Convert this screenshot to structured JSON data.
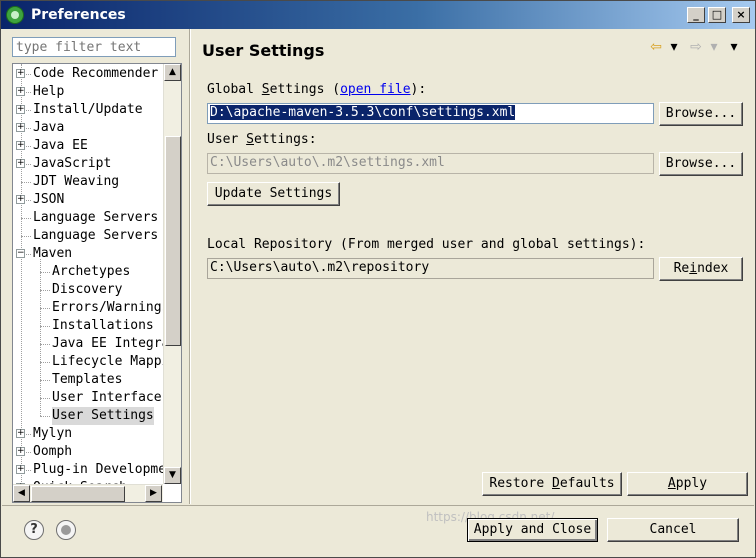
{
  "window": {
    "title": "Preferences",
    "minimize": "_",
    "maximize": "□",
    "close": "×"
  },
  "left": {
    "filter_placeholder": "type filter text",
    "tree": [
      {
        "label": "Code Recommender",
        "level": 0,
        "expander": "+"
      },
      {
        "label": "Help",
        "level": 0,
        "expander": "+"
      },
      {
        "label": "Install/Update",
        "level": 0,
        "expander": "+"
      },
      {
        "label": "Java",
        "level": 0,
        "expander": "+"
      },
      {
        "label": "Java EE",
        "level": 0,
        "expander": "+"
      },
      {
        "label": "JavaScript",
        "level": 0,
        "expander": "+"
      },
      {
        "label": "JDT Weaving",
        "level": 0,
        "expander": ""
      },
      {
        "label": "JSON",
        "level": 0,
        "expander": "+"
      },
      {
        "label": "Language Servers",
        "level": 0,
        "expander": ""
      },
      {
        "label": "Language Servers",
        "level": 0,
        "expander": ""
      },
      {
        "label": "Maven",
        "level": 0,
        "expander": "−"
      },
      {
        "label": "Archetypes",
        "level": 1,
        "expander": ""
      },
      {
        "label": "Discovery",
        "level": 1,
        "expander": ""
      },
      {
        "label": "Errors/Warnings",
        "level": 1,
        "expander": ""
      },
      {
        "label": "Installations",
        "level": 1,
        "expander": ""
      },
      {
        "label": "Java EE Integration",
        "level": 1,
        "expander": ""
      },
      {
        "label": "Lifecycle Mappings",
        "level": 1,
        "expander": ""
      },
      {
        "label": "Templates",
        "level": 1,
        "expander": ""
      },
      {
        "label": "User Interface",
        "level": 1,
        "expander": ""
      },
      {
        "label": "User Settings",
        "level": 1,
        "expander": "",
        "selected": true
      },
      {
        "label": "Mylyn",
        "level": 0,
        "expander": "+"
      },
      {
        "label": "Oomph",
        "level": 0,
        "expander": "+"
      },
      {
        "label": "Plug-in Development",
        "level": 0,
        "expander": "+"
      },
      {
        "label": "Quick Search",
        "level": 0,
        "expander": "+"
      }
    ],
    "scroll_up": "▲",
    "scroll_down": "▼",
    "scroll_left": "◀",
    "scroll_right": "▶"
  },
  "right": {
    "header": "User Settings",
    "global_settings_label_a": "Global ",
    "global_settings_label_u": "S",
    "global_settings_label_b": "ettings (",
    "open_file": "open file",
    "global_settings_label_c": "):",
    "global_settings_value": "D:\\apache-maven-3.5.3\\conf\\settings.xml",
    "browse_label": "Browse...",
    "user_settings_label_a": "User ",
    "user_settings_label_u": "S",
    "user_settings_label_b": "ettings:",
    "user_settings_value": "C:\\Users\\auto\\.m2\\settings.xml",
    "update_settings": "Update Settings",
    "local_repo_label": "Local Repository (From merged user and global settings):",
    "local_repo_value": "C:\\Users\\auto\\.m2\\repository",
    "reindex_a": "Re",
    "reindex_u": "i",
    "reindex_b": "ndex",
    "restore_defaults_a": "Restore ",
    "restore_defaults_u": "D",
    "restore_defaults_b": "efaults",
    "apply_u": "A",
    "apply_b": "pply"
  },
  "bottom": {
    "help_glyph": "?",
    "apply_and_close": "Apply and Close",
    "cancel": "Cancel",
    "watermark": "https://blog.csdn.net/..."
  },
  "nav": {
    "back": "⇦",
    "back_menu": "▾",
    "forward": "⇨",
    "forward_menu": "▾",
    "view_menu": "▾"
  },
  "colors": {
    "selection": "#0a246a",
    "link": "#0000ee",
    "title_gradient_start": "#0a246a"
  }
}
